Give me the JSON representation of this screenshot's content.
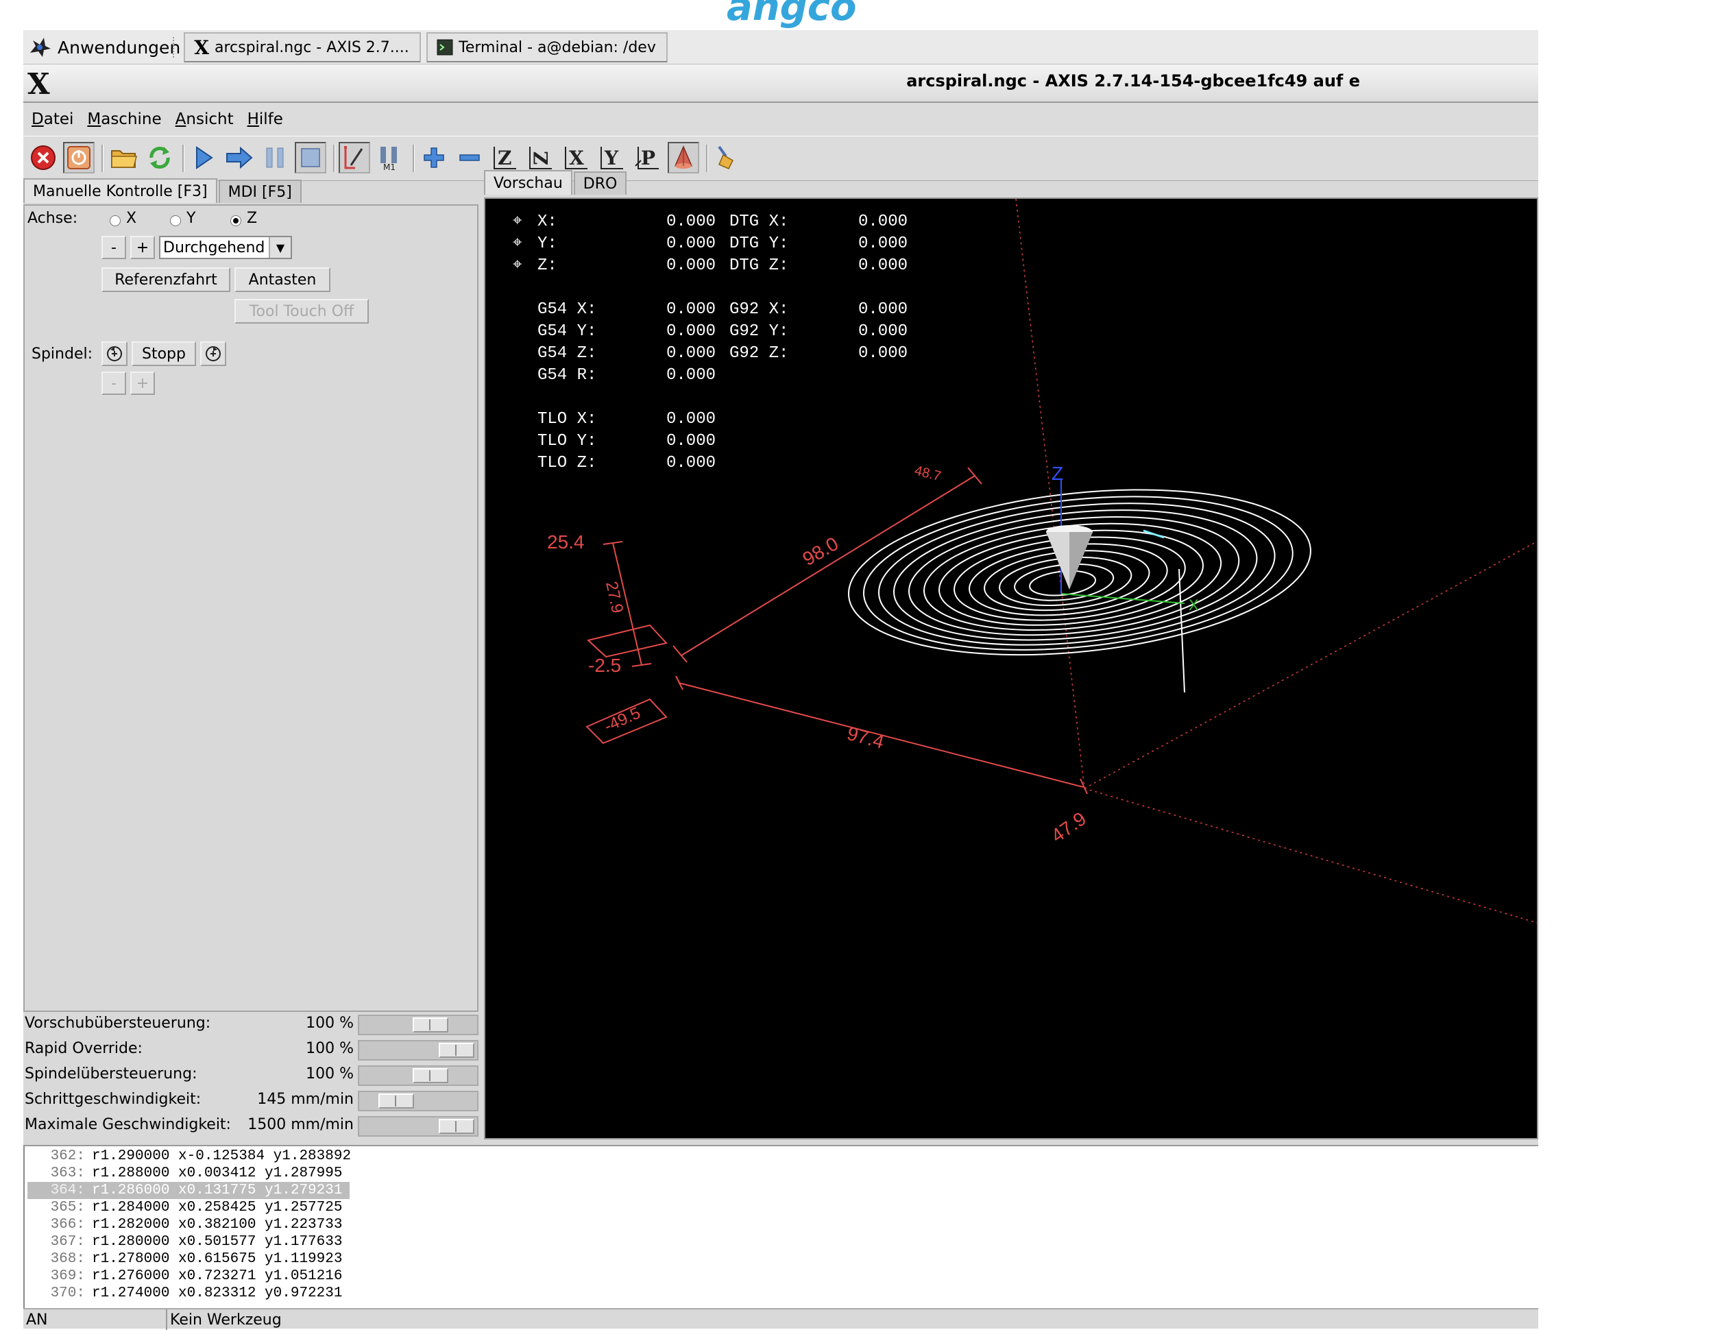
{
  "watermark": "angco",
  "taskbar": {
    "apps_label": "Anwendungen",
    "task_axis": "arcspiral.ngc - AXIS 2.7....",
    "task_terminal": "Terminal - a@debian: /dev"
  },
  "window": {
    "icon_letter": "X",
    "title": "arcspiral.ngc - AXIS 2.7.14-154-gbcee1fc49 auf  e"
  },
  "menu": [
    "Datei",
    "Maschine",
    "Ansicht",
    "Hilfe"
  ],
  "toolbar_icons": [
    "estop-icon",
    "power-icon",
    "open-file-icon",
    "reload-icon",
    "run-icon",
    "step-icon",
    "pause-icon",
    "stop-icon",
    "block-delete-icon",
    "optional-stop-icon",
    "zoom-in-icon",
    "zoom-out-icon",
    "view-z-icon",
    "view-z-rotated-icon",
    "view-x-icon",
    "view-y-icon",
    "view-p-icon",
    "toggle-rotate-icon",
    "clear-plot-icon"
  ],
  "left_tabs": {
    "manual": "Manuelle Kontrolle [F3]",
    "mdi": "MDI [F5]"
  },
  "manual": {
    "axis_label": "Achse:",
    "axes": [
      "X",
      "Y",
      "Z"
    ],
    "selected_axis": "Z",
    "jog_minus": "-",
    "jog_plus": "+",
    "jog_mode": "Durchgehend",
    "home_button": "Referenzfahrt",
    "touch_button": "Antasten",
    "tool_touch_off": "Tool Touch Off",
    "spindle_label": "Spindel:",
    "spindle_stop": "Stopp",
    "spindle_minus": "-",
    "spindle_plus": "+"
  },
  "overrides": [
    {
      "label": "Vorschubübersteuerung:",
      "value": "100 %",
      "position": 0.67
    },
    {
      "label": "Rapid Override:",
      "value": "100 %",
      "position": 1.0
    },
    {
      "label": "Spindelübersteuerung:",
      "value": "100 %",
      "position": 0.67
    },
    {
      "label": "Schrittgeschwindigkeit:",
      "value": "145 mm/min",
      "position": 0.23
    },
    {
      "label": "Maximale Geschwindigkeit:",
      "value": "1500 mm/min",
      "position": 1.0
    }
  ],
  "right_tabs": {
    "preview": "Vorschau",
    "dro": "DRO"
  },
  "dro_rows": [
    [
      "X:",
      "0.000",
      "DTG X:",
      "0.000"
    ],
    [
      "Y:",
      "0.000",
      "DTG Y:",
      "0.000"
    ],
    [
      "Z:",
      "0.000",
      "DTG Z:",
      "0.000"
    ],
    [
      "",
      "",
      "",
      ""
    ],
    [
      "G54 X:",
      "0.000",
      "G92 X:",
      "0.000"
    ],
    [
      "G54 Y:",
      "0.000",
      "G92 Y:",
      "0.000"
    ],
    [
      "G54 Z:",
      "0.000",
      "G92 Z:",
      "0.000"
    ],
    [
      "G54 R:",
      "0.000",
      "",
      ""
    ],
    [
      "",
      "",
      "",
      ""
    ],
    [
      "TLO X:",
      "0.000",
      "",
      ""
    ],
    [
      "TLO Y:",
      "0.000",
      "",
      ""
    ],
    [
      "TLO Z:",
      "0.000",
      "",
      ""
    ]
  ],
  "dimensions": {
    "x_extent": "97.4",
    "y_extent": "98.0",
    "x_min": "-49.5",
    "x_max": "47.9",
    "y_max": "48.7",
    "z_max": "25.4",
    "z_min": "-2.5",
    "z_extent": "27.9",
    "axis_z": "Z",
    "axis_x": "X"
  },
  "gcode": [
    {
      "no": "362:",
      "text": "r1.290000 x-0.125384 y1.283892"
    },
    {
      "no": "363:",
      "text": "r1.288000 x0.003412 y1.287995"
    },
    {
      "no": "364:",
      "text": "r1.286000 x0.131775 y1.279231"
    },
    {
      "no": "365:",
      "text": "r1.284000 x0.258425 y1.257725"
    },
    {
      "no": "366:",
      "text": "r1.282000 x0.382100 y1.223733"
    },
    {
      "no": "367:",
      "text": "r1.280000 x0.501577 y1.177633"
    },
    {
      "no": "368:",
      "text": "r1.278000 x0.615675 y1.119923"
    },
    {
      "no": "369:",
      "text": "r1.276000 x0.723271 y1.051216"
    },
    {
      "no": "370:",
      "text": "r1.274000 x0.823312 y0.972231"
    }
  ],
  "highlighted_line": "364:",
  "status": {
    "machine": "AN",
    "tool": "Kein Werkzeug"
  },
  "colors": {
    "preview_bg": "#000000",
    "limits": "#e34a4a",
    "toolpath": "#ffffff",
    "z_axis": "#3050ff",
    "x_axis": "#30c030"
  }
}
